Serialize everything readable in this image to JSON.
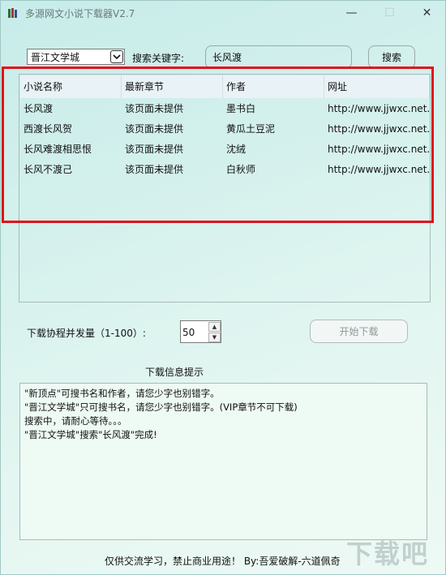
{
  "window": {
    "title": "多源网文小说下载器V2.7",
    "minimize_glyph": "—",
    "maximize_glyph": "☐",
    "close_glyph": "✕"
  },
  "search": {
    "source_selected": "晋江文学城",
    "keyword_label": "搜索关键字:",
    "keyword_value": "长风渡",
    "button_label": "搜索"
  },
  "results": {
    "columns": [
      "小说名称",
      "最新章节",
      "作者",
      "网址"
    ],
    "rows": [
      [
        "长风渡",
        "该页面未提供",
        "墨书白",
        "http://www.jjwxc.net..."
      ],
      [
        "西渡长风贺",
        "该页面未提供",
        "黄瓜土豆泥",
        "http://www.jjwxc.net..."
      ],
      [
        "长风难渡相思恨",
        "该页面未提供",
        "沈绒",
        "http://www.jjwxc.net..."
      ],
      [
        "长风不渡己",
        "该页面未提供",
        "白秋师",
        "http://www.jjwxc.net..."
      ]
    ]
  },
  "download": {
    "concurrency_label": "下载协程并发量（1-100）:",
    "concurrency_value": "50",
    "start_button": "开始下载"
  },
  "info": {
    "label": "下载信息提示",
    "lines": [
      "\"新顶点\"可搜书名和作者，请您少字也别错字。",
      "\"晋江文学城\"只可搜书名，请您少字也别错字。(VIP章节不可下载)",
      "搜索中，请耐心等待。。。",
      "\"晋江文学城\"搜索\"长风渡\"完成!"
    ]
  },
  "footer": "仅供交流学习，禁止商业用途！ By:吾爱破解-六道佩奇",
  "watermark": "下载吧",
  "colors": {
    "highlight": "#e0101c",
    "background": "#d3f0ec"
  },
  "icons": {
    "app": "app-icon",
    "dropdown": "chevron-down-icon",
    "spin_up": "spin-up-icon",
    "spin_down": "spin-down-icon"
  }
}
